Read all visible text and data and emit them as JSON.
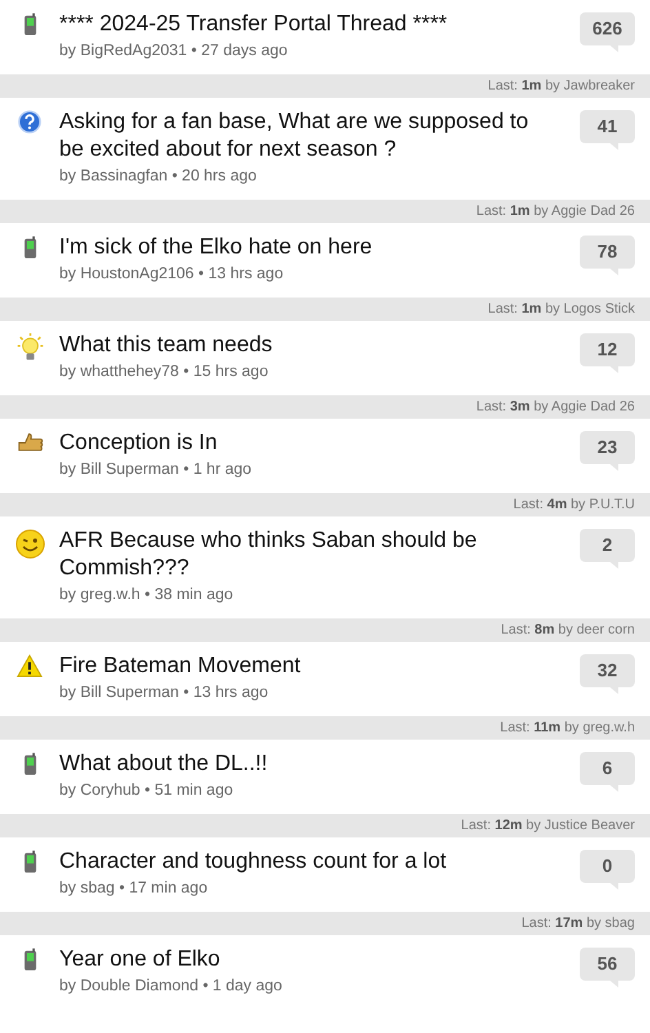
{
  "threads": [
    {
      "kind": "phone",
      "title": "**** 2024-25 Transfer Portal Thread ****",
      "meta": "by BigRedAg2031 • 27 days ago",
      "replies": "626",
      "last": "Last: **1m** by Jawbreaker"
    },
    {
      "kind": "question",
      "title": "Asking for a fan base, What are we supposed to be excited about for next season ?",
      "meta": "by Bassinagfan • 20 hrs ago",
      "replies": "41",
      "last": "Last: **1m** by Aggie Dad 26"
    },
    {
      "kind": "phone",
      "title": "I'm sick of the Elko hate on here",
      "meta": "by HoustonAg2106 • 13 hrs ago",
      "replies": "78",
      "last": "Last: **1m** by Logos Stick"
    },
    {
      "kind": "bulb",
      "title": "What this team needs",
      "meta": "by whatthehey78 • 15 hrs ago",
      "replies": "12",
      "last": "Last: **3m** by Aggie Dad 26"
    },
    {
      "kind": "thumb",
      "title": "Conception is In",
      "meta": "by Bill Superman • 1 hr ago",
      "replies": "23",
      "last": "Last: **4m** by P.U.T.U"
    },
    {
      "kind": "wink",
      "title": "AFR Because who thinks Saban should be Commish???",
      "meta": "by greg.w.h • 38 min ago",
      "replies": "2",
      "last": "Last: **8m** by deer corn"
    },
    {
      "kind": "warning",
      "title": "Fire Bateman Movement",
      "meta": "by Bill Superman • 13 hrs ago",
      "replies": "32",
      "last": "Last: **11m** by greg.w.h"
    },
    {
      "kind": "phone",
      "title": "What about the DL..!!",
      "meta": "by Coryhub • 51 min ago",
      "replies": "6",
      "last": "Last: **12m** by Justice Beaver"
    },
    {
      "kind": "phone",
      "title": "Character and toughness count for a lot",
      "meta": "by sbag • 17 min ago",
      "replies": "0",
      "last": "Last: **17m** by sbag"
    },
    {
      "kind": "phone",
      "title": "Year one of Elko",
      "meta": "by Double Diamond • 1 day ago",
      "replies": "56"
    }
  ]
}
